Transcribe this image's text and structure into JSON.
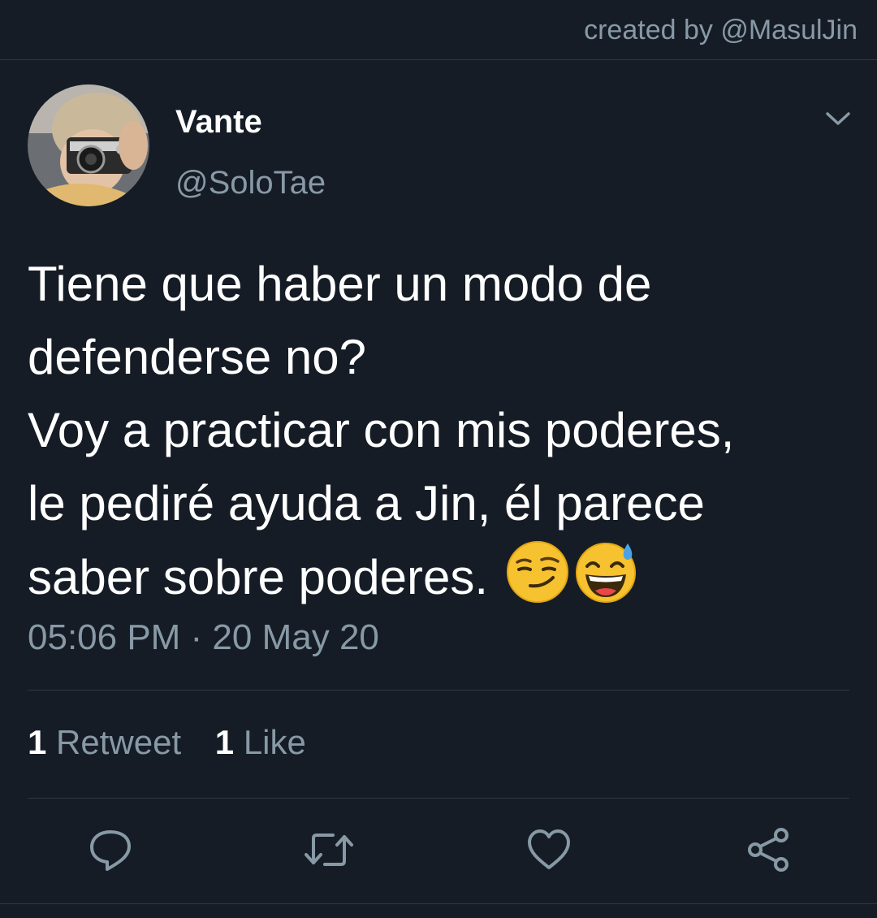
{
  "header": {
    "credit": "created by @MasulJin"
  },
  "user": {
    "display_name": "Vante",
    "handle": "@SoloTae",
    "avatar_icon": "avatar-photo"
  },
  "tweet": {
    "lines": [
      "Tiene que haber un modo de",
      "defenderse no?",
      "Voy a practicar con mis poderes,",
      "le pediré ayuda a Jin, él parece",
      "saber sobre poderes."
    ],
    "emojis": [
      "smirking-face",
      "grinning-face-with-sweat"
    ],
    "timestamp": "05:06 PM · 20 May 20"
  },
  "stats": {
    "retweet_count": "1",
    "retweet_label": "Retweet",
    "like_count": "1",
    "like_label": "Like"
  },
  "actions": [
    "reply-icon",
    "retweet-icon",
    "like-icon",
    "share-icon"
  ],
  "colors": {
    "background": "#151c25",
    "secondary_text": "#8899a6",
    "divider": "#2f3944"
  }
}
